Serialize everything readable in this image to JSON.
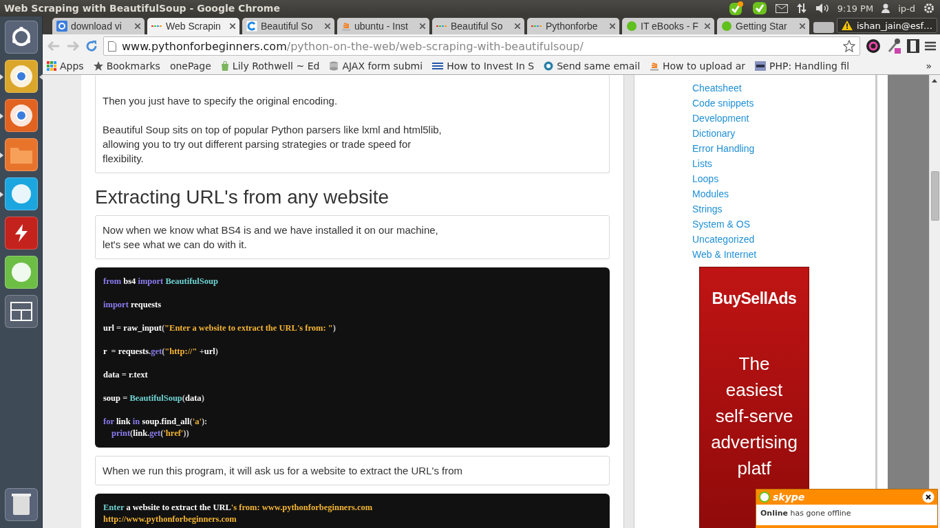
{
  "window": {
    "title": "Web Scraping with BeautifulSoup - Google Chrome"
  },
  "top_panel": {
    "time": "9:19 PM",
    "user": "ip-d"
  },
  "launcher": [
    {
      "kind": "dash",
      "color": "#5a6478",
      "running": false,
      "selected": false
    },
    {
      "kind": "ball",
      "color": "#dba72a",
      "running": true,
      "selected": true
    },
    {
      "kind": "ball",
      "color": "#e2621f",
      "running": true,
      "selected": false
    },
    {
      "kind": "folder",
      "color": "#e8742c",
      "running": true,
      "selected": false
    },
    {
      "kind": "bubble",
      "color": "#1ca6e0",
      "running": true,
      "selected": false
    },
    {
      "kind": "bolt",
      "color": "#c4221c",
      "running": false,
      "selected": false
    },
    {
      "kind": "bubble",
      "color": "#6cbe45",
      "running": false,
      "selected": false
    },
    {
      "kind": "panes",
      "color": "#56606e",
      "running": false,
      "selected": false
    }
  ],
  "tabs": [
    {
      "title": "download vi",
      "kind": "square",
      "selected": false
    },
    {
      "title": "Web Scrapin",
      "kind": "dots",
      "selected": true
    },
    {
      "title": "Beautiful So",
      "kind": "ring",
      "selected": false
    },
    {
      "title": "ubuntu - Inst",
      "kind": "stack",
      "selected": false
    },
    {
      "title": "Beautiful So",
      "kind": "dots",
      "selected": false
    },
    {
      "title": "Pythonforbe",
      "kind": "dots",
      "selected": false
    },
    {
      "title": "IT eBooks - F",
      "kind": "ball",
      "selected": false
    },
    {
      "title": "Getting Star",
      "kind": "ball",
      "selected": false
    }
  ],
  "profile": {
    "label": "ishan_jain@esf…"
  },
  "address_bar": {
    "domain": "www.pythonforbeginners.com",
    "path": "/python-on-the-web/web-scraping-with-beautifulsoup/"
  },
  "bookmarks": [
    {
      "label": "Apps",
      "kind": "grid"
    },
    {
      "label": "Bookmarks",
      "kind": "star"
    },
    {
      "label": "onePage",
      "kind": "none"
    },
    {
      "label": "Lily Rothwell ~ Ed",
      "kind": "bag"
    },
    {
      "label": "AJAX form submi",
      "kind": "db"
    },
    {
      "label": "How to Invest In S",
      "kind": "lines"
    },
    {
      "label": "Send same email",
      "kind": "circle"
    },
    {
      "label": "How to upload ar",
      "kind": "stack"
    },
    {
      "label": "PHP: Handling fil",
      "kind": "php"
    }
  ],
  "bookmarks_overflow": "»",
  "article": {
    "intro_paragraphs": [
      "Then you just have to specify the original encoding.",
      "Beautiful Soup sits on top of popular Python parsers like lxml and html5lib,\nallowing you to try out different parsing strategies or trade speed for\nflexibility."
    ],
    "heading": "Extracting URL's from any website",
    "paragraph_1": "Now when we know what BS4 is and we have installed it on our machine,\nlet's see what we can do with it.",
    "code": [
      {
        "kind": "statement",
        "tokens": [
          {
            "text": "from",
            "kind": "keyword"
          },
          {
            "text": " bs4 ",
            "kind": "name"
          },
          {
            "text": "import",
            "kind": "keyword"
          },
          {
            "text": " BeautifulSoup",
            "kind": "class"
          }
        ]
      },
      {
        "kind": "statement",
        "tokens": [
          {
            "text": "import",
            "kind": "keyword"
          },
          {
            "text": " requests",
            "kind": "name"
          }
        ]
      },
      {
        "kind": "statement",
        "tokens": [
          {
            "text": "url",
            "kind": "name"
          },
          {
            "text": " = ",
            "kind": "punct"
          },
          {
            "text": "raw_input",
            "kind": "name"
          },
          {
            "text": "(",
            "kind": "punct"
          },
          {
            "text": "\"Enter a website to extract the URL's from: \"",
            "kind": "string"
          },
          {
            "text": ")",
            "kind": "punct"
          }
        ]
      },
      {
        "kind": "statement",
        "tokens": [
          {
            "text": "r",
            "kind": "name"
          },
          {
            "text": "  = ",
            "kind": "punct"
          },
          {
            "text": "requests",
            "kind": "name"
          },
          {
            "text": ".",
            "kind": "punct"
          },
          {
            "text": "get",
            "kind": "keyword"
          },
          {
            "text": "(",
            "kind": "punct"
          },
          {
            "text": "\"http://\"",
            "kind": "string"
          },
          {
            "text": " +",
            "kind": "punct"
          },
          {
            "text": "url",
            "kind": "name"
          },
          {
            "text": ")",
            "kind": "punct"
          }
        ]
      },
      {
        "kind": "statement",
        "tokens": [
          {
            "text": "data",
            "kind": "name"
          },
          {
            "text": " = ",
            "kind": "punct"
          },
          {
            "text": "r",
            "kind": "name"
          },
          {
            "text": ".",
            "kind": "punct"
          },
          {
            "text": "text",
            "kind": "name"
          }
        ]
      },
      {
        "kind": "statement",
        "tokens": [
          {
            "text": "soup",
            "kind": "name"
          },
          {
            "text": " = ",
            "kind": "punct"
          },
          {
            "text": "BeautifulSoup",
            "kind": "class"
          },
          {
            "text": "(",
            "kind": "punct"
          },
          {
            "text": "data",
            "kind": "name"
          },
          {
            "text": ")",
            "kind": "punct"
          }
        ]
      },
      {
        "kind": "statement",
        "tokens": [
          {
            "text": "for",
            "kind": "keyword"
          },
          {
            "text": " link ",
            "kind": "name"
          },
          {
            "text": "in",
            "kind": "keyword"
          },
          {
            "text": " soup",
            "kind": "name"
          },
          {
            "text": ".",
            "kind": "punct"
          },
          {
            "text": "find_all",
            "kind": "name"
          },
          {
            "text": "(",
            "kind": "punct"
          },
          {
            "text": "'a'",
            "kind": "string"
          },
          {
            "text": "):",
            "kind": "punct"
          }
        ]
      },
      {
        "kind": "continuation",
        "tokens": [
          {
            "text": "print",
            "kind": "keyword"
          },
          {
            "text": "(",
            "kind": "punct"
          },
          {
            "text": "link",
            "kind": "name"
          },
          {
            "text": ".",
            "kind": "punct"
          },
          {
            "text": "get",
            "kind": "keyword"
          },
          {
            "text": "(",
            "kind": "punct"
          },
          {
            "text": "'href'",
            "kind": "string"
          },
          {
            "text": "))",
            "kind": "punct"
          }
        ]
      }
    ],
    "paragraph_2": "When we run this program, it will ask us for a website to extract the URL's from",
    "output": [
      [
        {
          "text": "Enter",
          "kind": "class"
        },
        {
          "text": " a website to extract the URL",
          "kind": "name"
        },
        {
          "text": "'s from: www.pythonforbeginners.com",
          "kind": "string"
        }
      ],
      [
        {
          "text": "http://www.pythonforbeginners.com",
          "kind": "string"
        }
      ]
    ]
  },
  "sidebar": {
    "categories": [
      "Cheatsheet",
      "Code snippets",
      "Development",
      "Dictionary",
      "Error Handling",
      "Lists",
      "Loops",
      "Modules",
      "Strings",
      "System & OS",
      "Uncategorized",
      "Web & Internet"
    ],
    "ad": {
      "logo": "BuySellAds",
      "lines": [
        "The",
        "easiest",
        "self-serve",
        "advertising",
        "platf"
      ]
    }
  },
  "notification": {
    "app": "skype",
    "message": "**Online** has gone offline"
  }
}
